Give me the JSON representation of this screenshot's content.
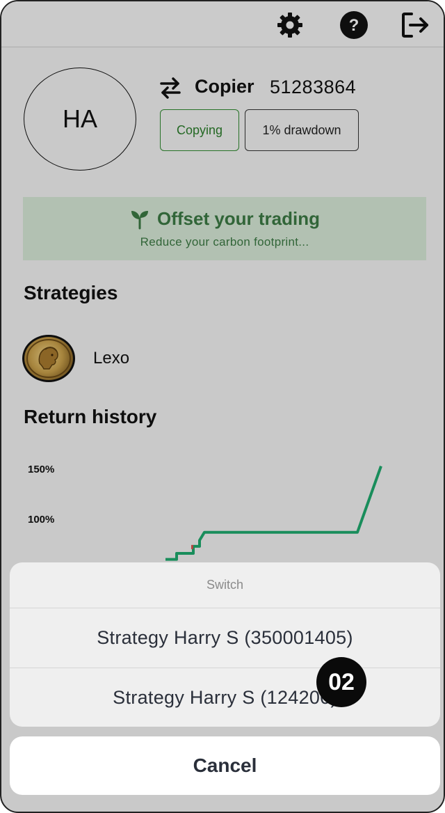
{
  "topbar": {
    "icons": [
      "gear-icon",
      "help-circle-icon",
      "logout-icon"
    ]
  },
  "profile": {
    "initials": "HA",
    "title": "Copier",
    "account_id": "51283864",
    "status_pill": "Copying",
    "drawdown_pill": "1% drawdown"
  },
  "banner": {
    "title": "Offset your trading",
    "subtitle": "Reduce your carbon footprint..."
  },
  "strategies": {
    "heading": "Strategies",
    "items": [
      {
        "name": "Lexo"
      }
    ]
  },
  "return_history": {
    "heading": "Return history"
  },
  "chart_data": {
    "type": "line",
    "title": "",
    "ytick_labels": [
      "150%",
      "100%"
    ],
    "y_ticks": [
      150,
      100
    ],
    "series": [
      {
        "color": "#1faa6e",
        "x": [
          0,
          1,
          2,
          3,
          4,
          5,
          6,
          7,
          8,
          9,
          10,
          11,
          12,
          13
        ],
        "values": [
          60,
          60,
          66,
          66,
          73,
          73,
          79,
          87,
          87,
          87,
          87,
          87,
          87,
          153
        ]
      }
    ],
    "colors": {
      "line": "#1faa6e",
      "dip": "#d9534f"
    }
  },
  "action_sheet": {
    "title": "Switch",
    "options": [
      "Strategy Harry S (350001405)",
      "Strategy Harry S (124200)"
    ],
    "cancel_label": "Cancel"
  },
  "step_badge": "02",
  "colors": {
    "accent_green": "#2b7d2b",
    "banner_bg": "#d7e8d6",
    "line_green": "#1faa6e"
  }
}
